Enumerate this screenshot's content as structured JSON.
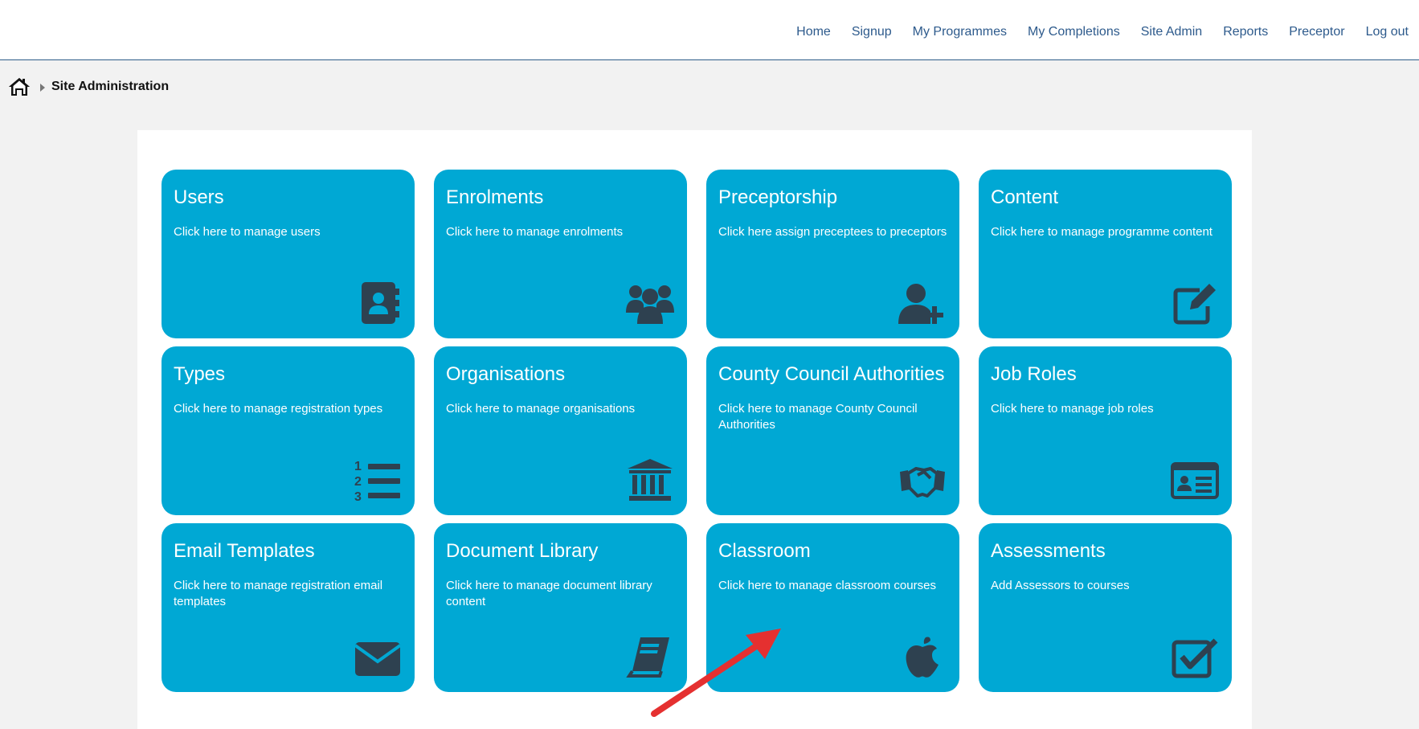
{
  "nav": {
    "items": [
      "Home",
      "Signup",
      "My Programmes",
      "My Completions",
      "Site Admin",
      "Reports",
      "Preceptor",
      "Log out"
    ]
  },
  "breadcrumb": {
    "home_icon": "home-icon",
    "current": "Site Administration"
  },
  "tiles": [
    {
      "title": "Users",
      "desc": "Click here to manage users",
      "icon": "address-book-icon"
    },
    {
      "title": "Enrolments",
      "desc": "Click here to manage enrolments",
      "icon": "users-group-icon"
    },
    {
      "title": "Preceptorship",
      "desc": "Click here assign preceptees to preceptors",
      "icon": "user-plus-icon"
    },
    {
      "title": "Content",
      "desc": "Click here to manage programme content",
      "icon": "edit-icon"
    },
    {
      "title": "Types",
      "desc": "Click here to manage registration types",
      "icon": "numbered-list-icon"
    },
    {
      "title": "Organisations",
      "desc": "Click here to manage organisations",
      "icon": "institution-icon"
    },
    {
      "title": "County Council Authorities",
      "desc": "Click here to manage County Council Authorities",
      "icon": "handshake-icon"
    },
    {
      "title": "Job Roles",
      "desc": "Click here to manage job roles",
      "icon": "id-card-icon"
    },
    {
      "title": "Email Templates",
      "desc": "Click here to manage registration email templates",
      "icon": "envelope-icon"
    },
    {
      "title": "Document Library",
      "desc": "Click here to manage document library content",
      "icon": "book-icon"
    },
    {
      "title": "Classroom",
      "desc": "Click here to manage classroom courses",
      "icon": "apple-icon"
    },
    {
      "title": "Assessments",
      "desc": "Add Assessors to courses",
      "icon": "check-square-icon"
    }
  ],
  "colors": {
    "tile_bg": "#00a8d4",
    "icon": "#2e4150",
    "nav_link": "#2d5a8c",
    "annotation_arrow": "#e53030"
  }
}
